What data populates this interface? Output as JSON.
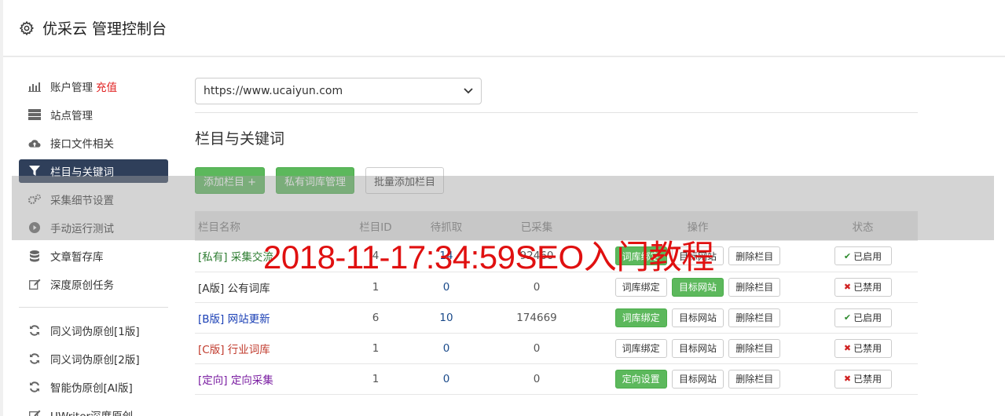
{
  "header": {
    "title": "优采云 管理控制台"
  },
  "sidebar": {
    "items": [
      {
        "label": "账户管理",
        "extra": "充值",
        "icon": "bar-chart-icon"
      },
      {
        "label": "站点管理",
        "icon": "server-icon"
      },
      {
        "label": "接口文件相关",
        "icon": "cloud-upload-icon"
      },
      {
        "label": "栏目与关键词",
        "icon": "filter-icon",
        "active": true
      },
      {
        "label": "采集细节设置",
        "icon": "cogs-icon"
      },
      {
        "label": "手动运行测试",
        "icon": "play-icon"
      },
      {
        "label": "文章暂存库",
        "icon": "database-icon"
      },
      {
        "label": "深度原创任务",
        "icon": "edit-icon"
      }
    ],
    "items2": [
      {
        "label": "同义词伪原创[1版]",
        "icon": "refresh-icon"
      },
      {
        "label": "同义词伪原创[2版]",
        "icon": "refresh-icon"
      },
      {
        "label": "智能伪原创[AI版]",
        "icon": "refresh-icon"
      },
      {
        "label": "UWriter深度原创",
        "icon": "edit-icon"
      }
    ]
  },
  "main": {
    "site_select": "https://www.ucaiyun.com",
    "section_title": "栏目与关键词",
    "buttons": {
      "add": "添加栏目 +",
      "private": "私有词库管理",
      "batch": "批量添加栏目"
    },
    "table": {
      "headers": [
        "栏目名称",
        "栏目ID",
        "待抓取",
        "已采集",
        "操作",
        "状态"
      ],
      "rows": [
        {
          "tag": "[私有]",
          "name": "采集交流",
          "id": "4",
          "pending": "14",
          "collected": "92460",
          "btn1": "词库绑定",
          "btn2": "目标网站",
          "btn3": "删除栏目",
          "status": "已启用"
        },
        {
          "tag": "[A版]",
          "name": "公有词库",
          "id": "1",
          "pending": "0",
          "collected": "0",
          "btn1": "词库绑定",
          "btn2": "目标网站",
          "btn3": "删除栏目",
          "status": "已禁用"
        },
        {
          "tag": "[B版]",
          "name": "网站更新",
          "id": "6",
          "pending": "10",
          "collected": "174669",
          "btn1": "词库绑定",
          "btn2": "目标网站",
          "btn3": "删除栏目",
          "status": "已启用"
        },
        {
          "tag": "[C版]",
          "name": "行业词库",
          "id": "1",
          "pending": "0",
          "collected": "0",
          "btn1": "词库绑定",
          "btn2": "目标网站",
          "btn3": "删除栏目",
          "status": "已禁用"
        },
        {
          "tag": "[定向]",
          "name": "定向采集",
          "id": "1",
          "pending": "0",
          "collected": "0",
          "btn1": "定向设置",
          "btn2": "目标网站",
          "btn3": "删除栏目",
          "status": "已禁用"
        }
      ]
    }
  },
  "watermark": "2018-11-17:34:59SEO入门教程",
  "colors": {
    "tag_private": "#2e7d32",
    "tag_a": "#333333",
    "tag_b": "#1a3fb5",
    "tag_c": "#c0392b",
    "tag_directed": "#7b1fa2",
    "green": "#5cb85c",
    "sidebar_active": "#2f3f5a"
  }
}
